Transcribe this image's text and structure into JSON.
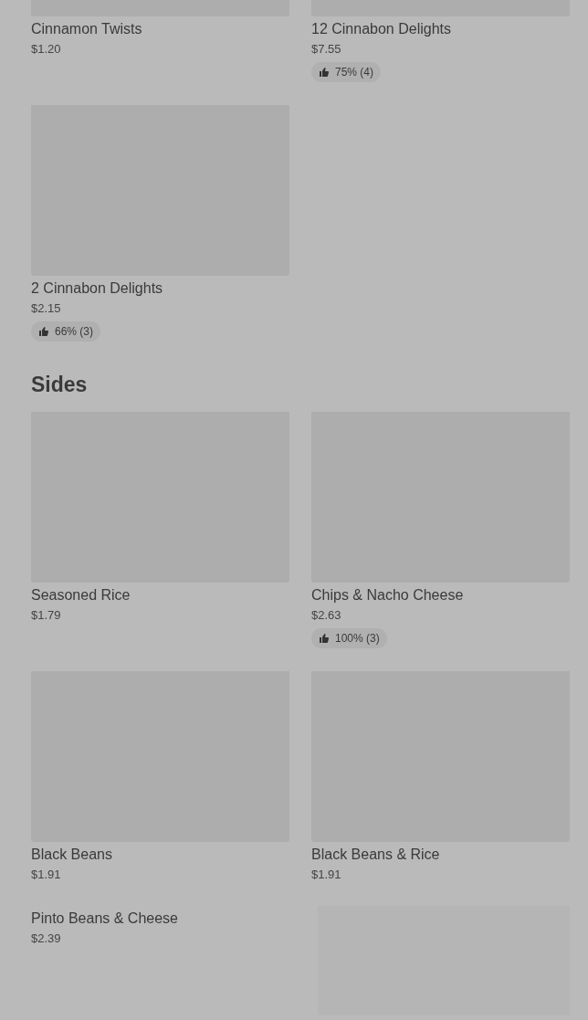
{
  "sections": [
    {
      "items": [
        {
          "kind": "vertical",
          "name": "Cinnamon Twists",
          "price": "$1.20"
        },
        {
          "kind": "vertical",
          "name": "12 Cinnabon Delights",
          "price": "$7.55",
          "rating": "75% (4)"
        },
        {
          "kind": "vertical",
          "name": "2 Cinnabon Delights",
          "price": "$2.15",
          "rating": "66% (3)"
        }
      ]
    },
    {
      "title": "Sides",
      "items": [
        {
          "kind": "vertical",
          "name": "Seasoned Rice",
          "price": "$1.79"
        },
        {
          "kind": "vertical",
          "name": "Chips & Nacho Cheese",
          "price": "$2.63",
          "rating": "100% (3)"
        },
        {
          "kind": "vertical",
          "name": "Black Beans",
          "price": "$1.91"
        },
        {
          "kind": "vertical",
          "name": "Black Beans & Rice",
          "price": "$1.91"
        },
        {
          "kind": "horizontal",
          "name": "Pinto Beans & Cheese",
          "price": "$2.39"
        }
      ]
    }
  ]
}
